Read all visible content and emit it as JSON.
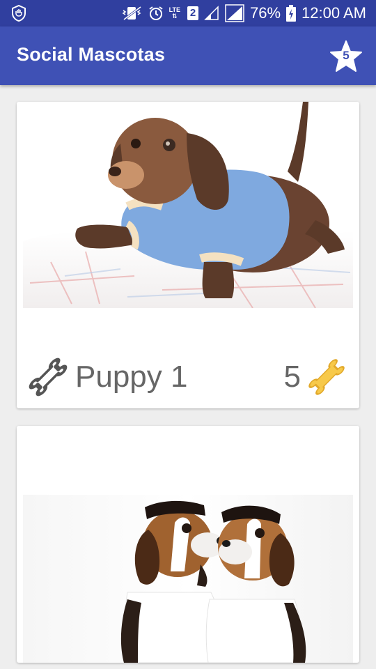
{
  "status_bar": {
    "lte": "LTE",
    "sim": "2",
    "battery": "76%",
    "time": "12:00 AM"
  },
  "app_bar": {
    "title": "Social Mascotas",
    "favorites_count": "5"
  },
  "pets": [
    {
      "name": "Puppy 1",
      "rating": "5"
    }
  ],
  "colors": {
    "status_bar": "#303f9f",
    "app_bar": "#3f51b5",
    "background": "#eeeeee",
    "bone_rated": "#f7c94a",
    "bone_outline": "#555555"
  }
}
